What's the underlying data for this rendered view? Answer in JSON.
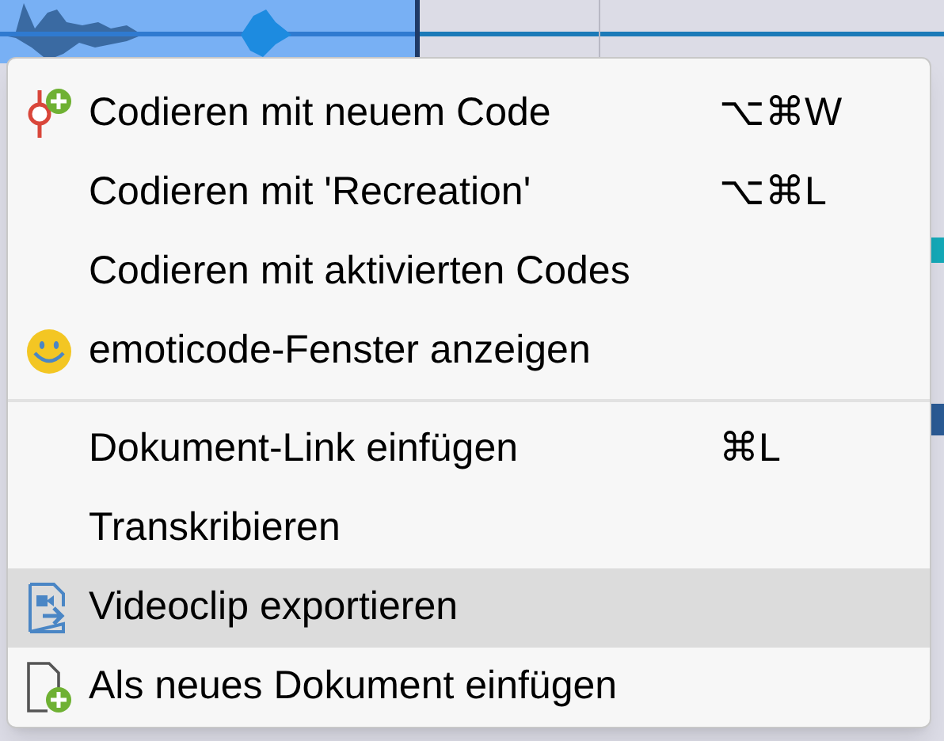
{
  "context_menu": {
    "groups": [
      {
        "items": [
          {
            "label": "Codieren mit neuem Code",
            "shortcut": "⌥⌘W",
            "selected": false
          },
          {
            "label": "Codieren mit 'Recreation'",
            "shortcut": "⌥⌘L",
            "selected": false
          },
          {
            "label": "Codieren mit aktivierten Codes",
            "selected": false
          },
          {
            "label": "emoticode-Fenster anzeigen",
            "selected": false
          }
        ]
      },
      {
        "items": [
          {
            "label": "Dokument-Link einfügen",
            "shortcut": "⌘L",
            "selected": false
          },
          {
            "label": "Transkribieren",
            "selected": false
          },
          {
            "label": "Videoclip exportieren",
            "selected": true
          },
          {
            "label": "Als neues Dokument einfügen",
            "selected": false
          }
        ]
      }
    ]
  }
}
